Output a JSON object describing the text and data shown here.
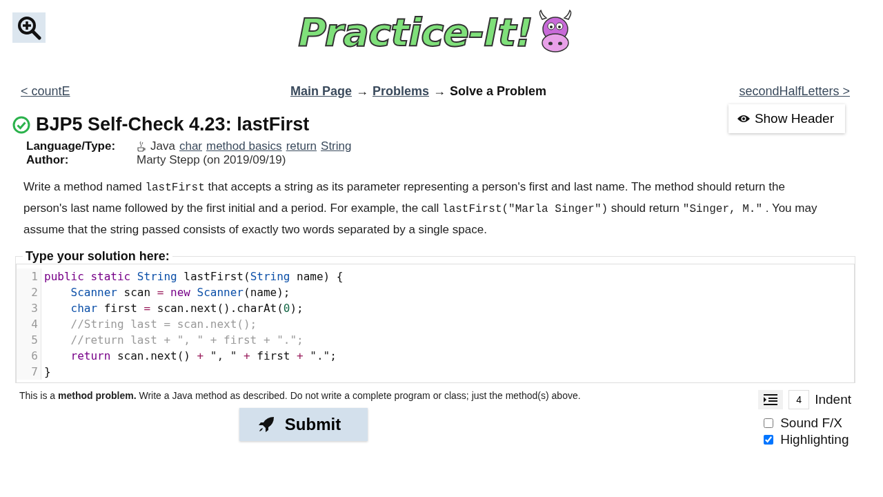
{
  "logo": {
    "text": "Practice-It!"
  },
  "nav": {
    "prev": "< countE",
    "crumbs": [
      {
        "text": "Main Page",
        "link": true
      },
      {
        "text": "→",
        "link": false
      },
      {
        "text": "Problems",
        "link": true
      },
      {
        "text": "→",
        "link": false
      },
      {
        "text": "Solve a Problem",
        "link": false
      }
    ],
    "next": "secondHalfLetters >"
  },
  "show_header_button": "Show Header",
  "problem": {
    "solved": true,
    "title": "BJP5 Self-Check 4.23: lastFirst",
    "meta": [
      {
        "label": "Language/Type:",
        "language": "Java",
        "tags": [
          "char",
          "method basics",
          "return",
          "String"
        ]
      },
      {
        "label": "Author:",
        "value": "Marty Stepp (on 2019/09/19)"
      }
    ],
    "description": [
      {
        "kind": "text",
        "text": "Write a method named "
      },
      {
        "kind": "code",
        "text": "lastFirst"
      },
      {
        "kind": "text",
        "text": " that accepts a string as its parameter representing a person's first and last name. The method should return the person's last name followed by the first initial and a period. For example, the call "
      },
      {
        "kind": "code",
        "text": "lastFirst(\"Marla Singer\")"
      },
      {
        "kind": "text",
        "text": " should return "
      },
      {
        "kind": "code",
        "text": "\"Singer, M.\""
      },
      {
        "kind": "text",
        "text": " . You may assume that the string passed consists of exactly two words separated by a single space."
      }
    ]
  },
  "editor": {
    "legend": "Type your solution here:",
    "lines": [
      {
        "number": "1",
        "indented": false,
        "tokens": [
          {
            "text": "public static ",
            "kind": "kw"
          },
          {
            "text": "String",
            "kind": "type"
          },
          {
            "text": " lastFirst(",
            "kind": "plain"
          },
          {
            "text": "String",
            "kind": "type"
          },
          {
            "text": " name) {",
            "kind": "plain"
          }
        ]
      },
      {
        "number": "2",
        "indented": true,
        "tokens": [
          {
            "text": "Scanner",
            "kind": "type"
          },
          {
            "text": " scan ",
            "kind": "plain"
          },
          {
            "text": "= ",
            "kind": "op"
          },
          {
            "text": "new ",
            "kind": "kw"
          },
          {
            "text": "Scanner",
            "kind": "type"
          },
          {
            "text": "(name);",
            "kind": "plain"
          }
        ]
      },
      {
        "number": "3",
        "indented": true,
        "tokens": [
          {
            "text": "char",
            "kind": "type"
          },
          {
            "text": " first ",
            "kind": "plain"
          },
          {
            "text": "=",
            "kind": "op"
          },
          {
            "text": " scan.next().charAt(",
            "kind": "plain"
          },
          {
            "text": "0",
            "kind": "num"
          },
          {
            "text": ");",
            "kind": "plain"
          }
        ]
      },
      {
        "number": "4",
        "indented": true,
        "tokens": [
          {
            "text": "//String last = scan.next();",
            "kind": "comment"
          }
        ]
      },
      {
        "number": "5",
        "indented": true,
        "tokens": [
          {
            "text": "//return last + \", \" + first + \".\";",
            "kind": "comment"
          }
        ]
      },
      {
        "number": "6",
        "indented": true,
        "tokens": [
          {
            "text": "return",
            "kind": "kw"
          },
          {
            "text": " scan.next()",
            "kind": "plain"
          },
          {
            "text": " + ",
            "kind": "op"
          },
          {
            "text": "\", \"",
            "kind": "str"
          },
          {
            "text": " + ",
            "kind": "op"
          },
          {
            "text": "first",
            "kind": "plain"
          },
          {
            "text": " + ",
            "kind": "op"
          },
          {
            "text": "\".\"",
            "kind": "str"
          },
          {
            "text": ";",
            "kind": "plain"
          }
        ]
      },
      {
        "number": "7",
        "indented": false,
        "tokens": [
          {
            "text": "}",
            "kind": "plain"
          }
        ]
      }
    ]
  },
  "note": "This is a **method problem.** Write a Java method as described. Do not write a complete program or class; just the method(s) above.",
  "submit_button": "Submit",
  "indent": {
    "value": "4",
    "label": "Indent"
  },
  "options": [
    {
      "label": "Sound F/X",
      "checked": false
    },
    {
      "label": "Highlighting",
      "checked": true
    }
  ]
}
